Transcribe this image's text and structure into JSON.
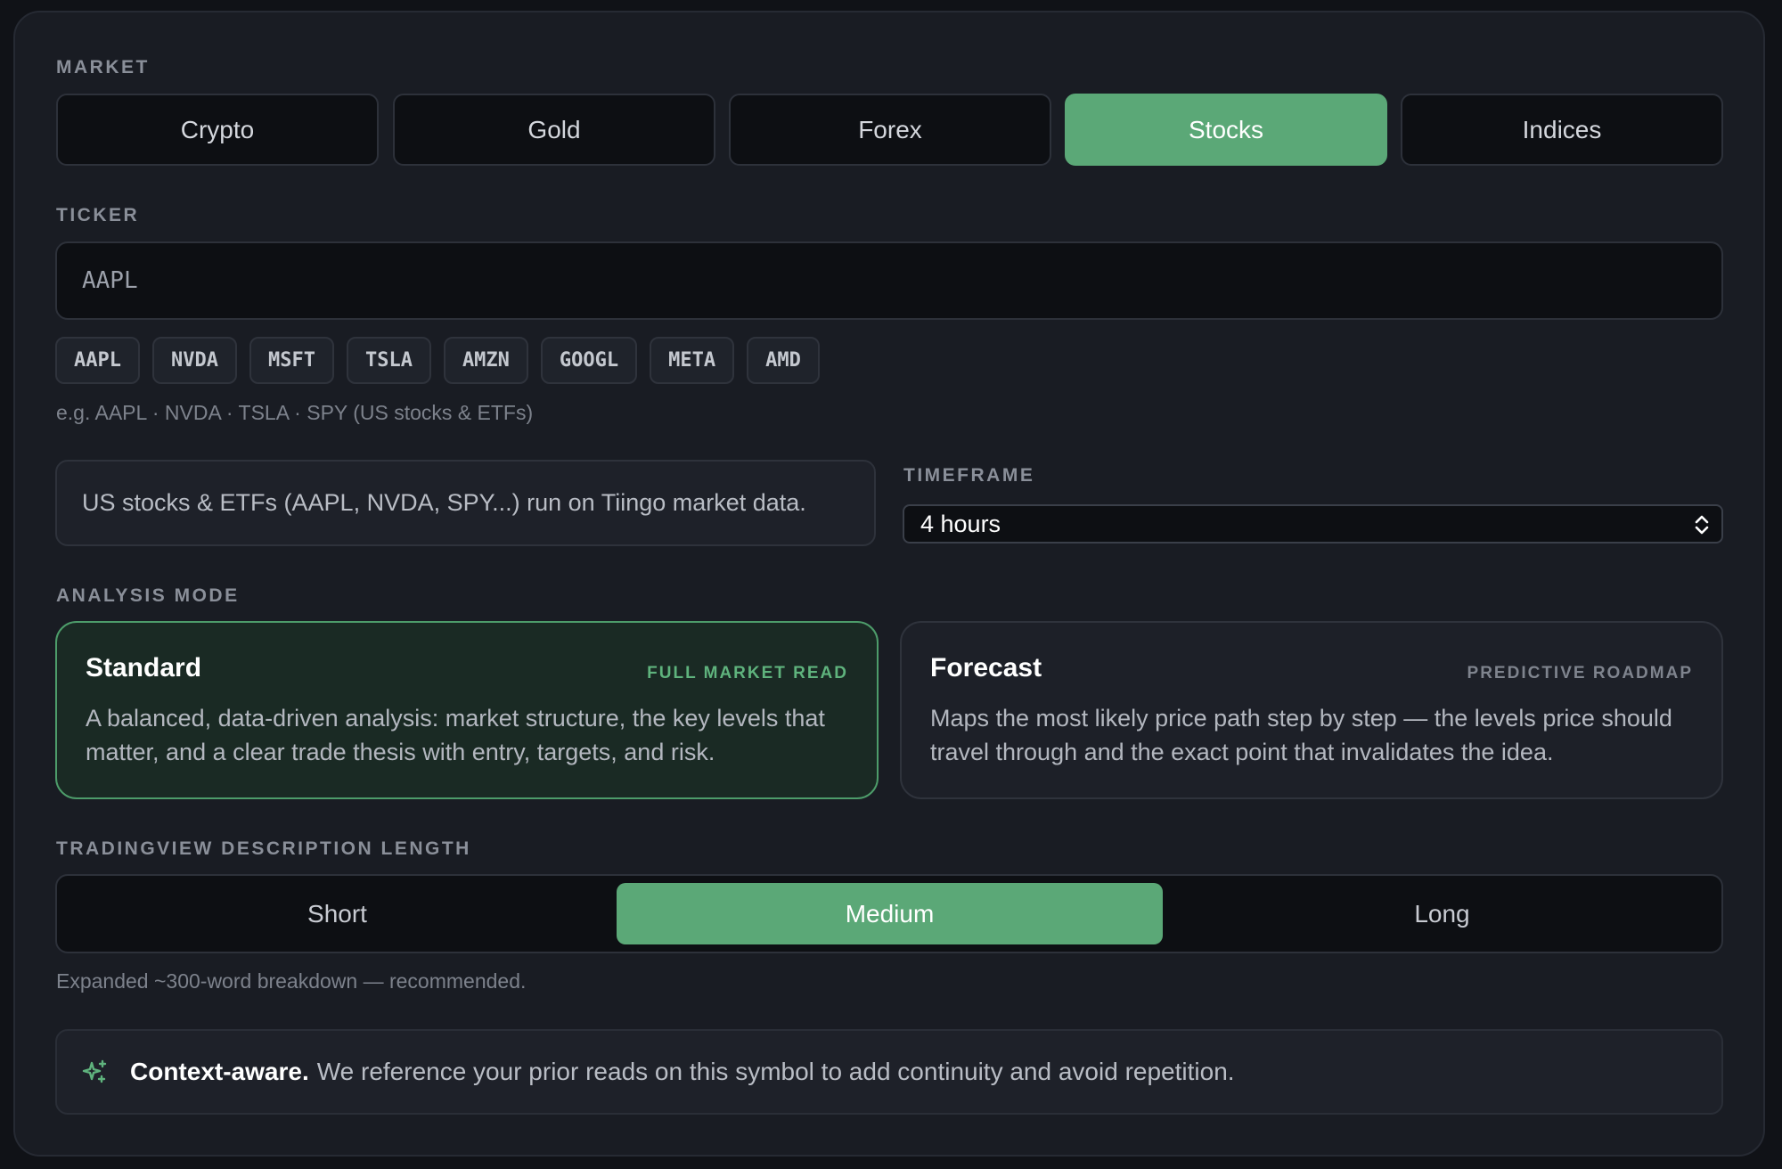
{
  "market": {
    "label": "MARKET",
    "options": [
      "Crypto",
      "Gold",
      "Forex",
      "Stocks",
      "Indices"
    ],
    "selected": "Stocks"
  },
  "ticker": {
    "label": "TICKER",
    "placeholder": "AAPL",
    "chips": [
      "AAPL",
      "NVDA",
      "MSFT",
      "TSLA",
      "AMZN",
      "GOOGL",
      "META",
      "AMD"
    ],
    "hint": "e.g. AAPL · NVDA · TSLA · SPY (US stocks & ETFs)"
  },
  "data_source_note": "US stocks & ETFs (AAPL, NVDA, SPY...) run on Tiingo market data.",
  "timeframe": {
    "label": "TIMEFRAME",
    "value": "4 hours"
  },
  "analysis_mode": {
    "label": "ANALYSIS MODE",
    "selected": "Standard",
    "modes": [
      {
        "title": "Standard",
        "tag": "FULL MARKET READ",
        "description": "A balanced, data-driven analysis: market structure, the key levels that matter, and a clear trade thesis with entry, targets, and risk."
      },
      {
        "title": "Forecast",
        "tag": "PREDICTIVE ROADMAP",
        "description": "Maps the most likely price path step by step — the levels price should travel through and the exact point that invalidates the idea."
      }
    ]
  },
  "description_length": {
    "label": "TRADINGVIEW DESCRIPTION LENGTH",
    "options": [
      "Short",
      "Medium",
      "Long"
    ],
    "selected": "Medium",
    "hint": "Expanded ~300-word breakdown — recommended."
  },
  "context_note": {
    "strong": "Context-aware.",
    "text": "We reference your prior reads on this symbol to add continuity and avoid repetition.",
    "icon": "sparkles-icon"
  },
  "colors": {
    "accent": "#5ba877",
    "background": "#191c23"
  }
}
